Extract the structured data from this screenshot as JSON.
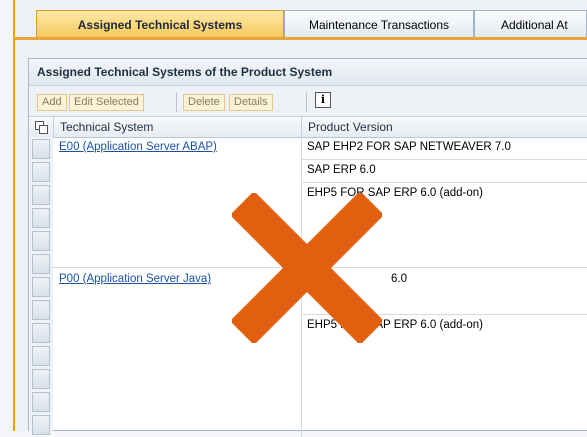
{
  "tabs": [
    {
      "label": "Assigned Technical Systems",
      "active": true
    },
    {
      "label": "Maintenance Transactions",
      "active": false
    },
    {
      "label": "Additional At",
      "active": false
    }
  ],
  "panel": {
    "title": "Assigned Technical Systems of the Product System"
  },
  "toolbar": {
    "add": "Add",
    "edit_selected": "Edit Selected",
    "delete": "Delete",
    "details": "Details",
    "info_icon": "info-icon",
    "info_glyph": "i"
  },
  "table": {
    "columns": [
      "Technical System",
      "Product Version"
    ],
    "groups": [
      {
        "system": "E00 (Application Server ABAP)",
        "versions": [
          "SAP EHP2 FOR SAP NETWEAVER 7.0",
          "SAP ERP 6.0",
          "EHP5 FOR SAP ERP 6.0 (add-on)"
        ]
      },
      {
        "system": "P00 (Application Server Java)",
        "versions": [
          "6.0",
          "",
          "EHP5 FOR SAP ERP 6.0 (add-on)"
        ]
      }
    ]
  },
  "overlay": {
    "color": "#e25f10",
    "icon": "x-cross-icon"
  },
  "colors": {
    "accent": "#f0a000",
    "link": "#1a52a6"
  }
}
